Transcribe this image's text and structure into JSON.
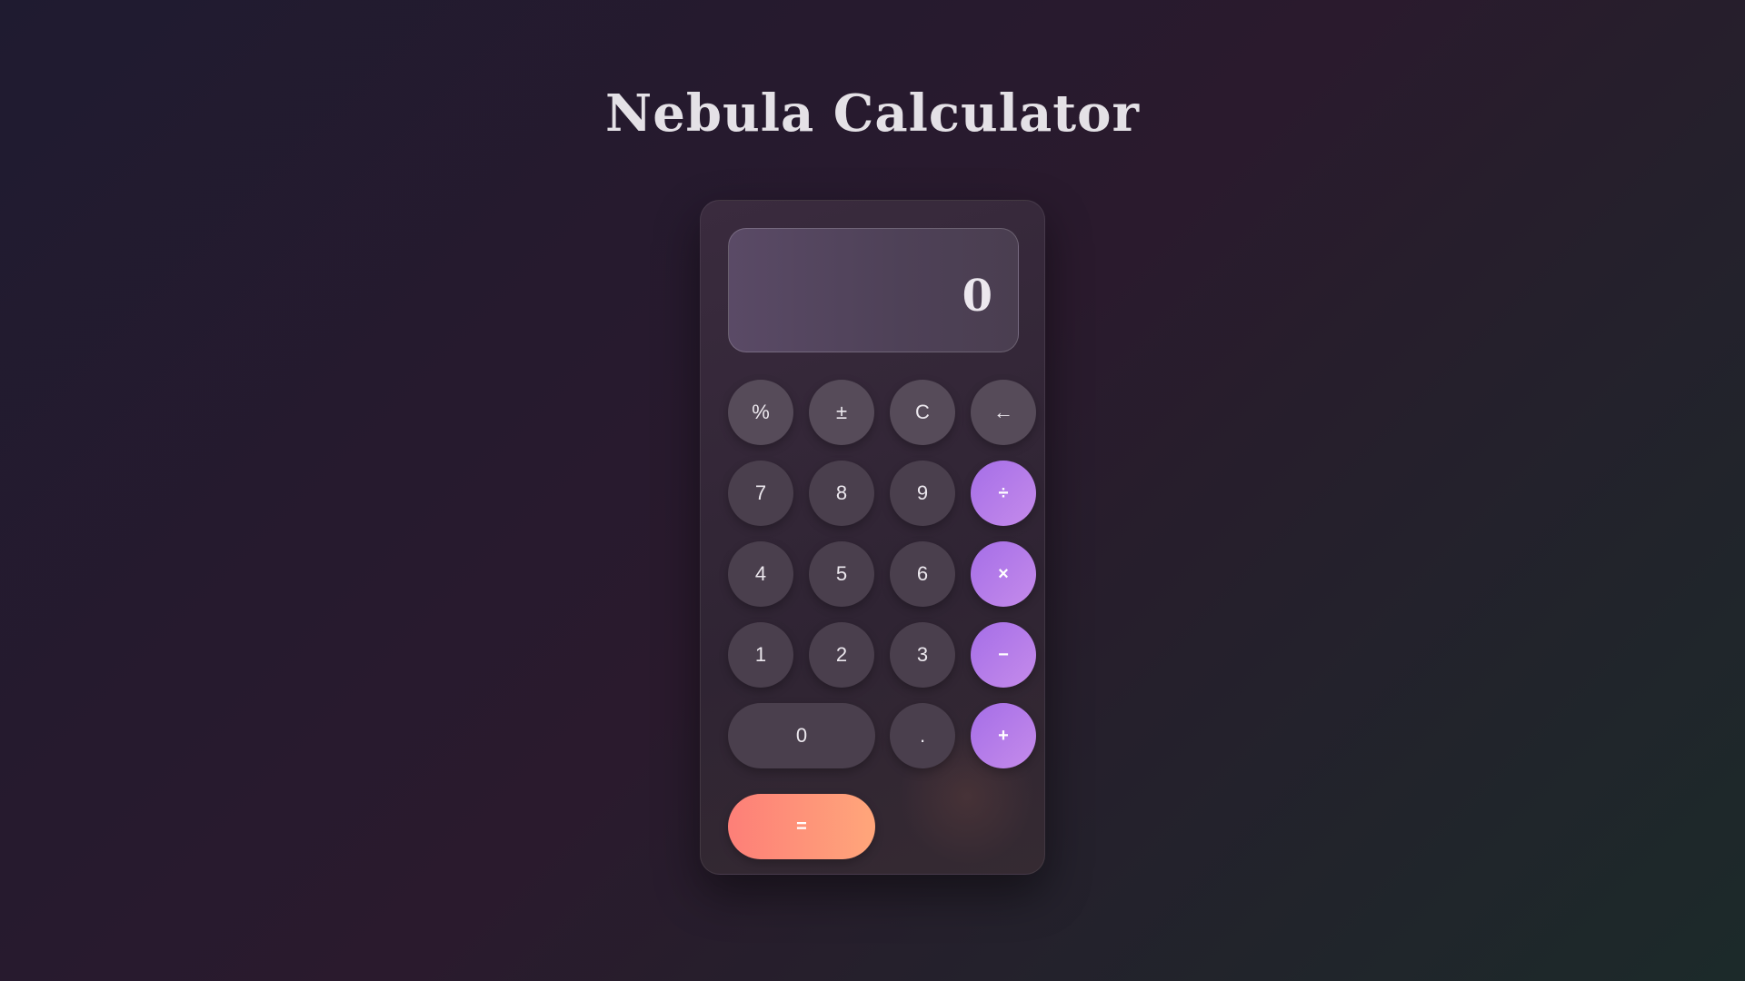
{
  "app": {
    "title": "Nebula Calculator"
  },
  "display": {
    "value": "0"
  },
  "keypad": {
    "percent": "%",
    "plus_minus": "±",
    "clear": "C",
    "backspace": "←",
    "seven": "7",
    "eight": "8",
    "nine": "9",
    "divide": "÷",
    "four": "4",
    "five": "5",
    "six": "6",
    "multiply": "×",
    "one": "1",
    "two": "2",
    "three": "3",
    "subtract": "−",
    "zero": "0",
    "decimal": ".",
    "add": "+",
    "equals": "="
  },
  "colors": {
    "operator_accent": "#b57ae9",
    "equals_gradient_start": "#fd7f78",
    "equals_gradient_end": "#ffa67a",
    "digit_button": "#4a3f4d",
    "background": "#241b2c"
  }
}
